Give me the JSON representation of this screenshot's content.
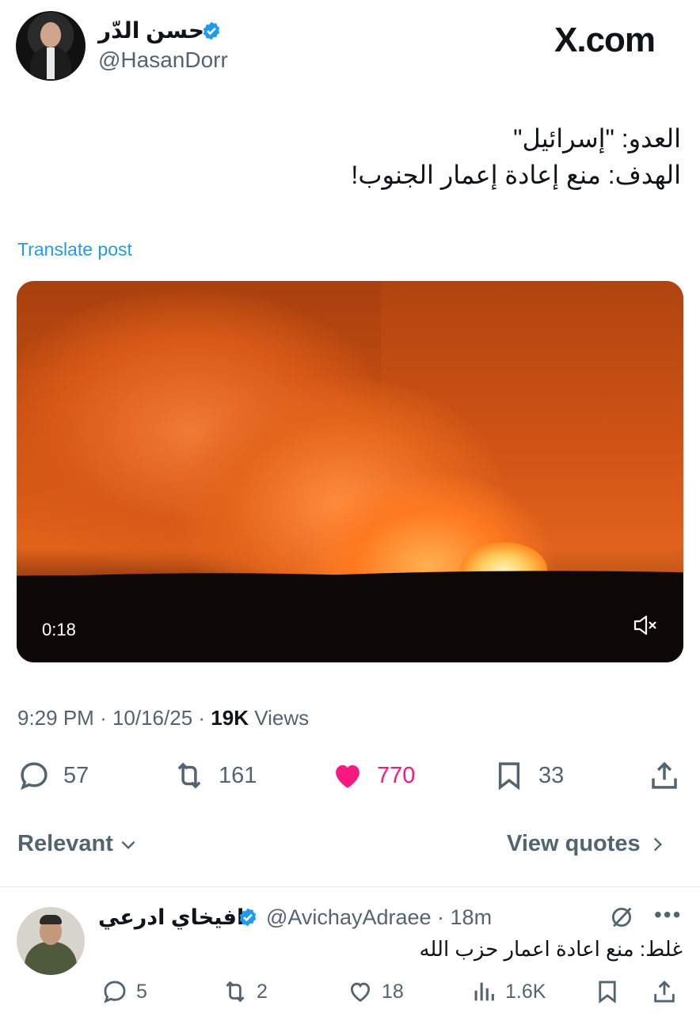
{
  "header": {
    "display_name": "حسن الدّر",
    "handle": "@HasanDorr",
    "verified": true,
    "logo": "X.com"
  },
  "tweet": {
    "lines": [
      "العدو: \"إسرائيل\"",
      "الهدف: منع إعادة إعمار الجنوب!"
    ],
    "translate_label": "Translate post",
    "video": {
      "duration": "0:18",
      "mute_icon": "speaker-muted-icon"
    },
    "meta": {
      "time": "9:29 PM",
      "date": "10/16/25",
      "views_count": "19K",
      "views_label": "Views",
      "separator": "·"
    },
    "actions": {
      "replies": "57",
      "retweets": "161",
      "likes": "770",
      "bookmarks": "33"
    }
  },
  "sort": {
    "relevant_label": "Relevant",
    "view_quotes_label": "View quotes"
  },
  "reply": {
    "display_name": "افيخاي ادرعي",
    "handle": "@AvichayAdraee",
    "separator": "·",
    "time": "18m",
    "verified": true,
    "text": "غلط: منع اعادة اعمار حزب الله",
    "actions": {
      "replies": "5",
      "retweets": "2",
      "likes": "18",
      "views": "1.6K"
    }
  },
  "colors": {
    "accent": "#1d9bf0",
    "like": "#f91880",
    "muted": "#536471",
    "text": "#0f1419"
  }
}
